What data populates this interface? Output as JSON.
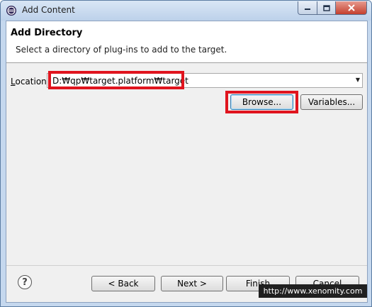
{
  "window": {
    "title": "Add Content",
    "app_icon": "eclipse-icon",
    "controls": {
      "minimize_icon": "minimize-icon",
      "maximize_icon": "maximize-icon",
      "close_icon": "close-icon"
    }
  },
  "header": {
    "title": "Add Directory",
    "description": "Select a directory of plug-ins to add to the target."
  },
  "location": {
    "label_mnemonic": "L",
    "label_rest": "ocation:",
    "value": "D:₩qp₩target.platform₩target"
  },
  "buttons": {
    "browse": "Browse...",
    "variables": "Variables...",
    "back": "< Back",
    "next": "Next >",
    "finish": "Finish",
    "cancel": "Cancel"
  },
  "footer": {
    "help_icon": "help-icon"
  },
  "watermark": "http://www.xenomity.com",
  "colors": {
    "highlight": "#e0141e",
    "titlebar": "#c5d8ee"
  }
}
